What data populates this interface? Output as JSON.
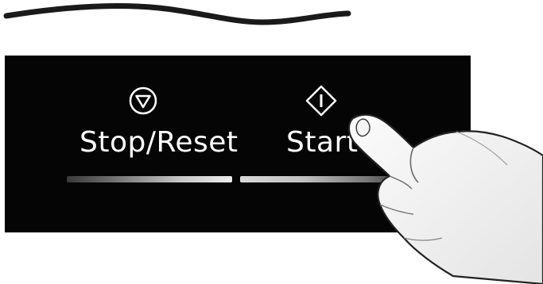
{
  "panel": {
    "stop_reset_button": {
      "label": "Stop/Reset",
      "icon": "stop-reset-icon"
    },
    "start_button": {
      "label": "Start",
      "icon": "start-icon"
    }
  },
  "illustration": {
    "hand": "hand-pressing-icon"
  },
  "colors": {
    "panel_background": "#050505",
    "label_text": "#ffffff",
    "background": "#ffffff"
  }
}
